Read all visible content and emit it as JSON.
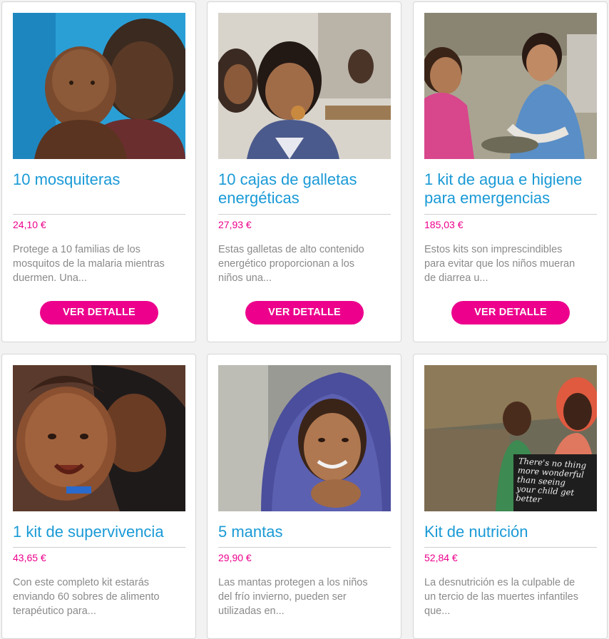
{
  "products": [
    {
      "image_icon": "mother-holding-baby-photo",
      "title": "10 mosquiteras",
      "price": "24,10 €",
      "description_lines": [
        "Protege a 10 familias de los",
        "mosquitos de la malaria mientras",
        "duermen. Una..."
      ],
      "button_label": "VER DETALLE"
    },
    {
      "image_icon": "children-eating-biscuits-photo",
      "title": "10 cajas de galletas energéticas",
      "price": "27,93 €",
      "description_lines": [
        "Estas galletas de alto contenido",
        "energético proporcionan a los",
        "niños una..."
      ],
      "button_label": "VER DETALLE"
    },
    {
      "image_icon": "girls-washing-hands-photo",
      "title": "1 kit de agua e higiene para emergencias",
      "price": "185,03 €",
      "description_lines": [
        "Estos kits son imprescindibles",
        "para evitar que los niños mueran",
        "de diarrea u..."
      ],
      "button_label": "VER DETALLE"
    },
    {
      "image_icon": "mother-kissing-baby-photo",
      "title": "1 kit de supervivencia",
      "price": "43,65 €",
      "description_lines": [
        "Con este completo kit estarás",
        "enviando 60 sobres de alimento",
        "terapéutico para..."
      ]
    },
    {
      "image_icon": "smiling-child-blanket-photo",
      "title": "5 mantas",
      "price": "29,90 €",
      "description_lines": [
        "Las mantas protegen a los niños",
        "del frío invierno, pueden ser",
        "utilizadas en..."
      ]
    },
    {
      "image_icon": "mother-child-chalkboard-photo",
      "title": "Kit de nutrición",
      "price": "52,84 €",
      "description_lines": [
        "La desnutrición es la culpable de",
        "un tercio de las muertes infantiles",
        "que..."
      ],
      "chalkboard_text": [
        "There's no thing",
        "more wonderful",
        "than seeing",
        "your child get",
        "better"
      ]
    }
  ],
  "colors": {
    "accent_blue": "#1a9ad6",
    "brand_magenta": "#ec008c",
    "text_gray": "#8a8a8a"
  }
}
